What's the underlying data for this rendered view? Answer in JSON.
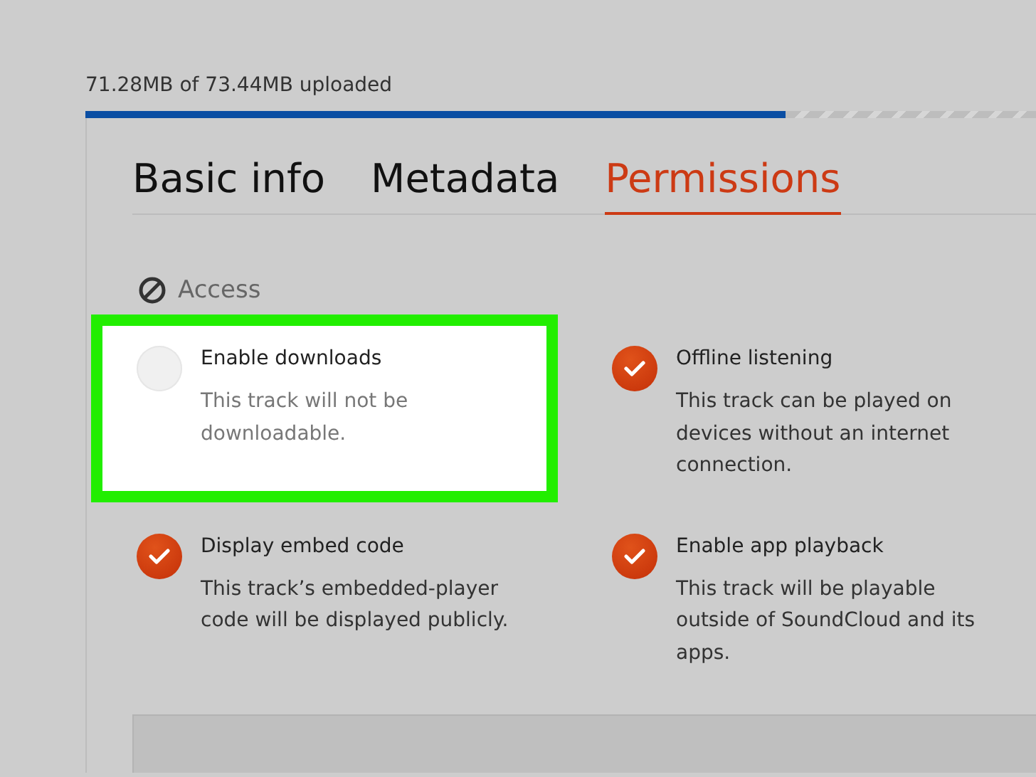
{
  "upload": {
    "status": "71.28MB of 73.44MB uploaded",
    "level": 0.737
  },
  "tabs": [
    {
      "label": "Basic info",
      "selected": false
    },
    {
      "label": "Metadata",
      "selected": false
    },
    {
      "label": "Permissions",
      "selected": true
    }
  ],
  "section": {
    "title": "Access"
  },
  "options": [
    {
      "title": "Enable downloads",
      "description": "This track will not be downloadable.",
      "checked": false,
      "highlighted": true
    },
    {
      "title": "Offline listening",
      "description": "This track can be played on devices without an internet connection.",
      "checked": true,
      "highlighted": false
    },
    {
      "title": "Display embed code",
      "description": "This track’s embedded-player code will be displayed publicly.",
      "checked": true,
      "highlighted": false
    },
    {
      "title": "Enable app playback",
      "description": "This track will be playable outside of SoundCloud and its apps.",
      "checked": true,
      "highlighted": false
    }
  ]
}
